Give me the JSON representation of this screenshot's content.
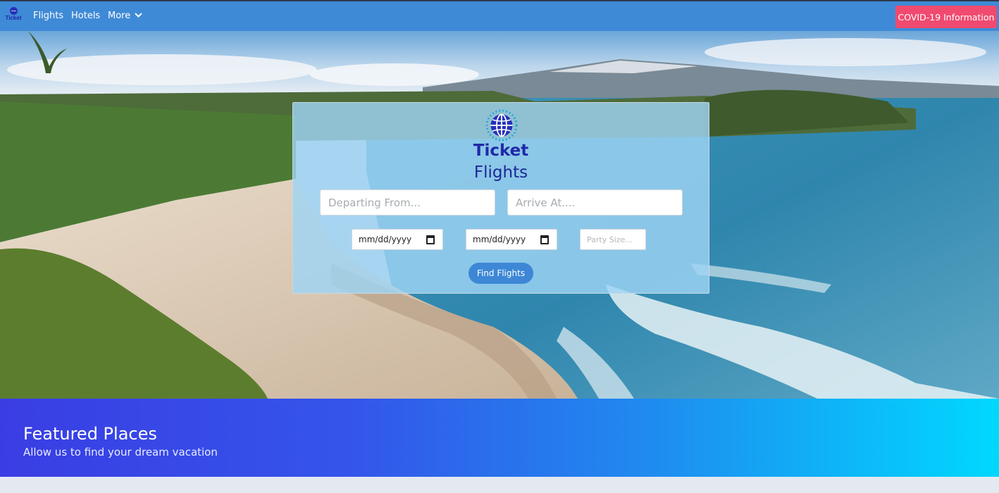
{
  "navbar": {
    "brand_label": "Ticket",
    "links": [
      "Flights",
      "Hotels",
      "More"
    ],
    "covid_button": "COVID-19 Information"
  },
  "icons": {
    "brand": "globe-icon",
    "more_menu": "chevron-down-icon",
    "card_logo": "globe-icon",
    "date": "calendar-icon"
  },
  "hero": {
    "image_subject": "beach-coastline"
  },
  "search": {
    "brand": "Ticket",
    "title": "Flights",
    "depart_placeholder": "Departing From...",
    "arrive_placeholder": "Arrive At....",
    "depart_date": "mm/dd/yyyy",
    "return_date": "mm/dd/yyyy",
    "party_placeholder": "Party Size...",
    "submit_label": "Find Flights"
  },
  "featured": {
    "title": "Featured Places",
    "subtitle": "Allow us to find your dream vacation"
  },
  "colors": {
    "navbar": "#3f8ad6",
    "covid_button": "#f04a70",
    "brand_text": "#2129a8",
    "find_button": "#3d87d6",
    "featured_start": "#3a3de4",
    "featured_end": "#00d8ff"
  }
}
